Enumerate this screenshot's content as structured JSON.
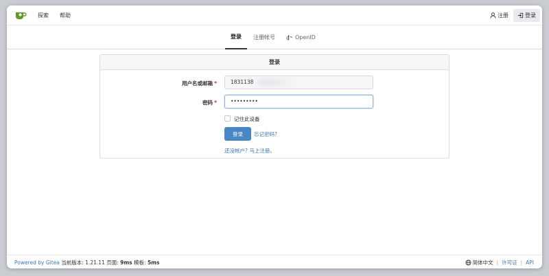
{
  "nav": {
    "explore": "探索",
    "help": "帮助",
    "register": "注册",
    "login": "登录"
  },
  "tabs": [
    {
      "label": "登录",
      "active": true
    },
    {
      "label": "注册帐号",
      "active": false
    },
    {
      "label": "OpenID",
      "active": false
    }
  ],
  "card": {
    "title": "登录",
    "username_label": "用户名或邮箱",
    "username_value": "1831138",
    "password_label": "密码",
    "password_value": "•••••••••",
    "remember_label": "记住此设备",
    "login_button": "登录",
    "forgot_link": "忘记密码?",
    "register_link": "还没帐户? 马上注册。"
  },
  "footer": {
    "powered": "Powered by Gitea",
    "version_text": "当前版本: 1.21.11 页面: ",
    "page_time": "9ms",
    "template_text": " 模板: ",
    "template_time": "5ms",
    "language": "简体中文",
    "license": "许可证",
    "api": "API"
  },
  "colors": {
    "accent": "#4a86c5",
    "link": "#3a78b8",
    "logo_green": "#609926"
  }
}
